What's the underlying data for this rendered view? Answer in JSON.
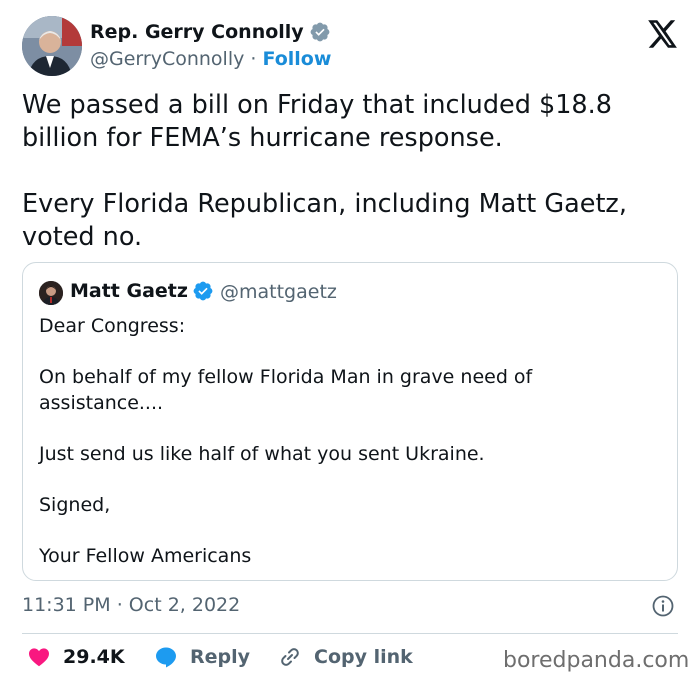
{
  "author": {
    "name": "Rep. Gerry Connolly",
    "handle": "@GerryConnolly",
    "separator": "·",
    "follow_label": "Follow"
  },
  "tweet": {
    "paragraphs": [
      "We passed a bill on Friday that included $18.8 billion for FEMA’s hurricane response.",
      "Every Florida Republican, including Matt Gaetz, voted no."
    ]
  },
  "quoted": {
    "name": "Matt Gaetz",
    "handle": "@mattgaetz",
    "paragraphs": [
      "Dear Congress:",
      "On behalf of my fellow Florida Man in grave need of assistance....",
      "Just send us like half of what you sent Ukraine.",
      "Signed,",
      "Your Fellow Americans"
    ]
  },
  "meta": {
    "time": "11:31 PM",
    "separator": "·",
    "date": "Oct 2, 2022"
  },
  "actions": {
    "likes_count": "29.4K",
    "reply_label": "Reply",
    "copy_link_label": "Copy link"
  },
  "watermark": "boredpanda.com",
  "icons": {
    "verified": "verified-badge-icon",
    "x_logo": "x-logo-icon",
    "info": "info-icon",
    "heart": "heart-icon",
    "reply": "reply-bubble-icon",
    "link": "link-icon"
  },
  "colors": {
    "accent_blue": "#1d9bf0",
    "like_red": "#f91880",
    "text": "#0f1419",
    "muted": "#536471",
    "border": "#cfd9de"
  }
}
